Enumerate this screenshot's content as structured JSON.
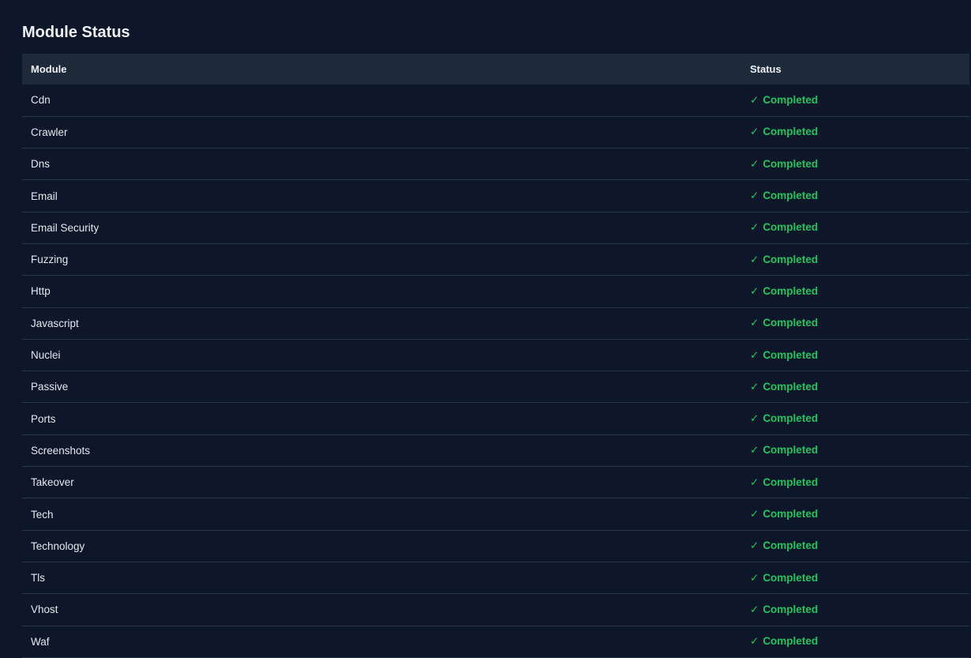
{
  "section": {
    "title": "Module Status"
  },
  "table": {
    "headers": {
      "module": "Module",
      "status": "Status"
    },
    "rows": [
      {
        "module": "Cdn",
        "status": "Completed"
      },
      {
        "module": "Crawler",
        "status": "Completed"
      },
      {
        "module": "Dns",
        "status": "Completed"
      },
      {
        "module": "Email",
        "status": "Completed"
      },
      {
        "module": "Email Security",
        "status": "Completed"
      },
      {
        "module": "Fuzzing",
        "status": "Completed"
      },
      {
        "module": "Http",
        "status": "Completed"
      },
      {
        "module": "Javascript",
        "status": "Completed"
      },
      {
        "module": "Nuclei",
        "status": "Completed"
      },
      {
        "module": "Passive",
        "status": "Completed"
      },
      {
        "module": "Ports",
        "status": "Completed"
      },
      {
        "module": "Screenshots",
        "status": "Completed"
      },
      {
        "module": "Takeover",
        "status": "Completed"
      },
      {
        "module": "Tech",
        "status": "Completed"
      },
      {
        "module": "Technology",
        "status": "Completed"
      },
      {
        "module": "Tls",
        "status": "Completed"
      },
      {
        "module": "Vhost",
        "status": "Completed"
      },
      {
        "module": "Waf",
        "status": "Completed"
      }
    ]
  },
  "icons": {
    "check": "check-icon",
    "check_glyph": "✓"
  },
  "colors": {
    "background": "#0e1629",
    "header_bg": "#1e2a3a",
    "status_completed": "#22c55e"
  }
}
